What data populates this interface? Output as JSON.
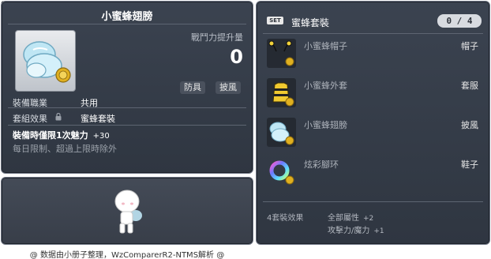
{
  "item_id": "01102391",
  "item": {
    "name": "小蜜蜂翅膀",
    "stat_label": "戰鬥力提升量",
    "stat_value": "0",
    "chips": [
      "防具",
      "披風"
    ],
    "job_label": "裝備職業",
    "job_value": "共用",
    "set_label": "套組效果",
    "set_value": "蜜蜂套裝",
    "bonus_label": "裝備時僅限1次魅力",
    "bonus_value": "+30",
    "note": "每日限制、超過上限時除外",
    "icon": "bee-wings-icon"
  },
  "preview": {
    "icon": "character-avatar"
  },
  "set": {
    "badge": "SET",
    "name": "蜜蜂套裝",
    "count": "0 / 4",
    "items": [
      {
        "name": "小蜜蜂帽子",
        "slot": "帽子",
        "icon": "bee-hat-icon"
      },
      {
        "name": "小蜜蜂外套",
        "slot": "套服",
        "icon": "bee-coat-icon"
      },
      {
        "name": "小蜜蜂翅膀",
        "slot": "披風",
        "icon": "bee-wings-icon"
      },
      {
        "name": "炫彩腳环",
        "slot": "鞋子",
        "icon": "rainbow-ring-icon"
      }
    ],
    "effect_label": "4套裝效果",
    "effects": [
      {
        "text": "全部屬性",
        "value": "+2"
      },
      {
        "text": "攻擊力/魔力",
        "value": "+1"
      }
    ]
  },
  "footer": "@ 数据由小册子整理，WzComparerR2-NTMS解析 @",
  "colors": {
    "panel": "#353c48",
    "accent": "#ffffff",
    "coin": "#e0b020"
  }
}
